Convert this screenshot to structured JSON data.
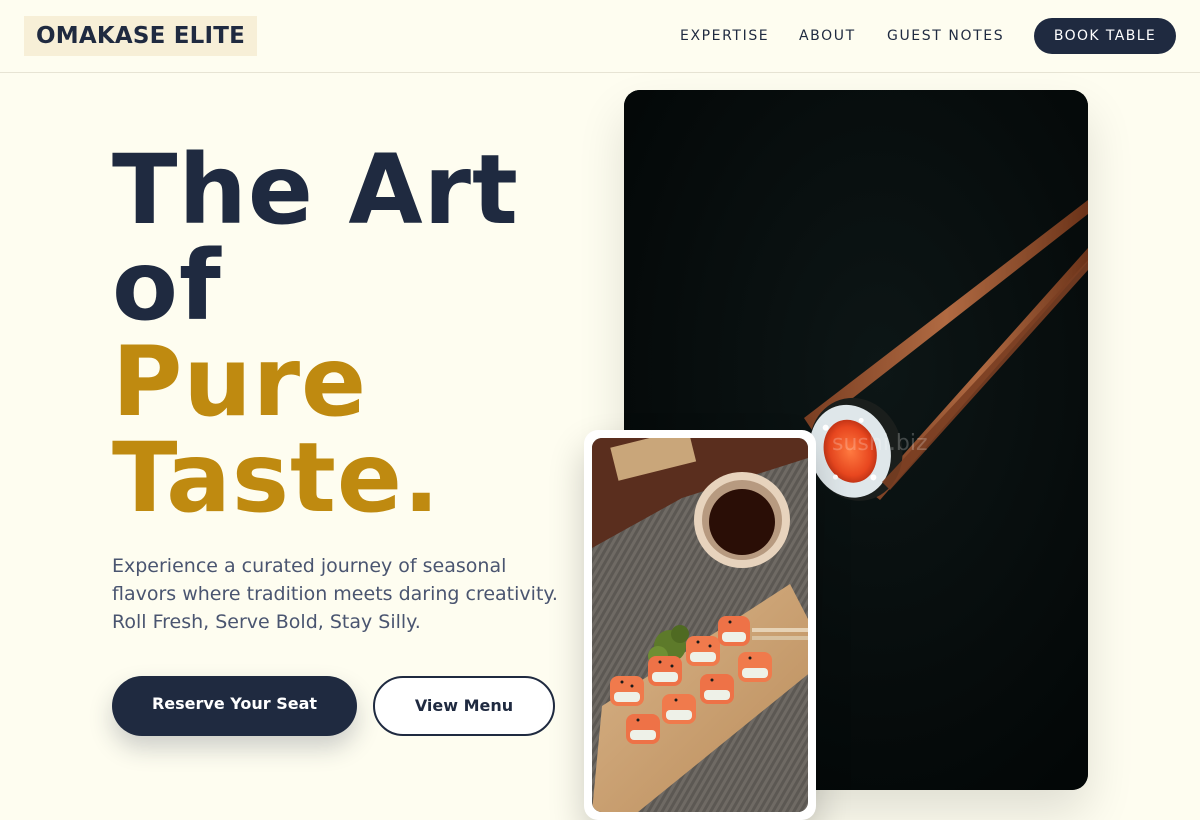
{
  "header": {
    "brand": "OMAKASE ELITE",
    "nav": [
      "EXPERTISE",
      "ABOUT",
      "GUEST NOTES"
    ],
    "cta": "BOOK TABLE"
  },
  "hero": {
    "headline_line1": "The Art",
    "headline_line2": "of",
    "headline_line3": "Pure",
    "headline_line4": "Taste.",
    "description": "Experience a curated journey of seasonal flavors where tradition meets daring creativity. Roll Fresh, Serve Bold, Stay Silly.",
    "primary_button": "Reserve Your Seat",
    "secondary_button": "View Menu"
  },
  "images": {
    "main": "sushi-roll-chopsticks-photo",
    "secondary": "sushi-platter-soy-sauce-photo",
    "watermark": "sushi.biz"
  },
  "colors": {
    "background": "#fefdf0",
    "navy": "#1f2a40",
    "gold": "#bf8a10",
    "logo_bg": "#f7efd7"
  }
}
